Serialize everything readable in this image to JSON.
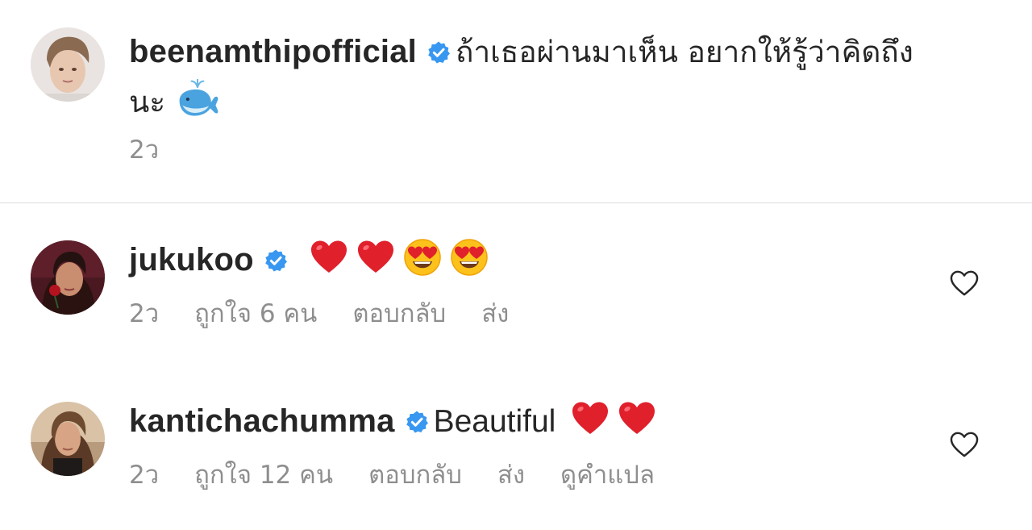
{
  "caption": {
    "username": "beenamthipofficial",
    "text_line1": "ถ้าเธอผ่านมาเห็น อยากให้รู้ว่าคิดถึง",
    "text_line2": "นะ",
    "time": "2ว",
    "emoji": [
      "spouting-whale"
    ]
  },
  "comments": [
    {
      "username": "jukukoo",
      "emojis": [
        "red-heart",
        "red-heart",
        "heart-eyes",
        "heart-eyes"
      ],
      "time": "2ว",
      "likes": "ถูกใจ 6 คน",
      "reply": "ตอบกลับ",
      "send": "ส่ง"
    },
    {
      "username": "kantichachumma",
      "text": "Beautiful",
      "emojis": [
        "red-heart",
        "red-heart"
      ],
      "time": "2ว",
      "likes": "ถูกใจ 12 คน",
      "reply": "ตอบกลับ",
      "send": "ส่ง",
      "translate": "ดูคำแปล"
    }
  ],
  "colors": {
    "verified": "#3897f0",
    "meta_text": "#8e8e8e",
    "primary_text": "#262626",
    "divider": "#dbdbdb"
  }
}
